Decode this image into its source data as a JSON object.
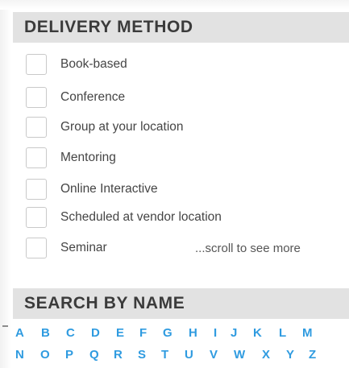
{
  "delivery": {
    "title": "DELIVERY METHOD",
    "options": [
      {
        "label": "Book-based",
        "checked": false
      },
      {
        "label": "Conference",
        "checked": false
      },
      {
        "label": "Group at your location",
        "checked": false
      },
      {
        "label": "Mentoring",
        "checked": false
      },
      {
        "label": "Online Interactive",
        "checked": false
      },
      {
        "label": "Scheduled at vendor location",
        "checked": false
      },
      {
        "label": "Seminar",
        "checked": false
      }
    ],
    "scroll_hint": "...scroll to see more"
  },
  "search_by_name": {
    "title": "SEARCH BY NAME",
    "row1": [
      "A",
      "B",
      "C",
      "D",
      "E",
      "F",
      "G",
      "H",
      "I",
      "J",
      "K",
      "L",
      "M"
    ],
    "row2": [
      "N",
      "O",
      "P",
      "Q",
      "R",
      "S",
      "T",
      "U",
      "V",
      "W",
      "X",
      "Y",
      "Z"
    ]
  },
  "colors": {
    "header_bg": "#e2e2e2",
    "header_text": "#3b3b3b",
    "letter_link": "#2f9be0",
    "checkbox_border": "#c9c9c9"
  }
}
